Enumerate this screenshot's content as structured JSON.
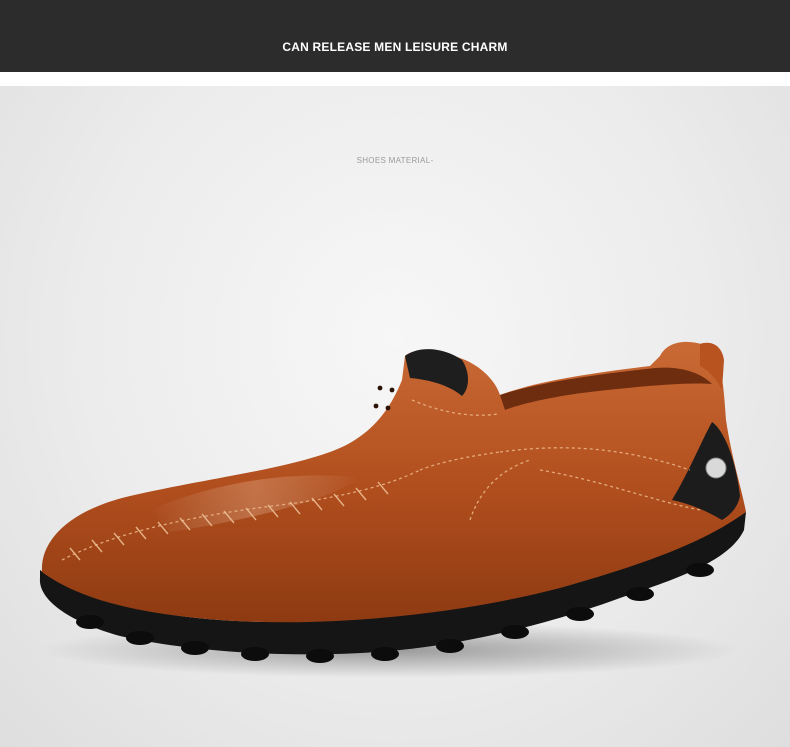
{
  "banner": {
    "title": "CAN RELEASE MEN LEISURE CHARM"
  },
  "caption": {
    "text": "SHOES MATERIAL-"
  },
  "product": {
    "image": "brown-leather-slip-on-loafer",
    "upper_color": "#b8521f",
    "sole_color": "#141414",
    "accent_color": "#1e1e1e"
  }
}
